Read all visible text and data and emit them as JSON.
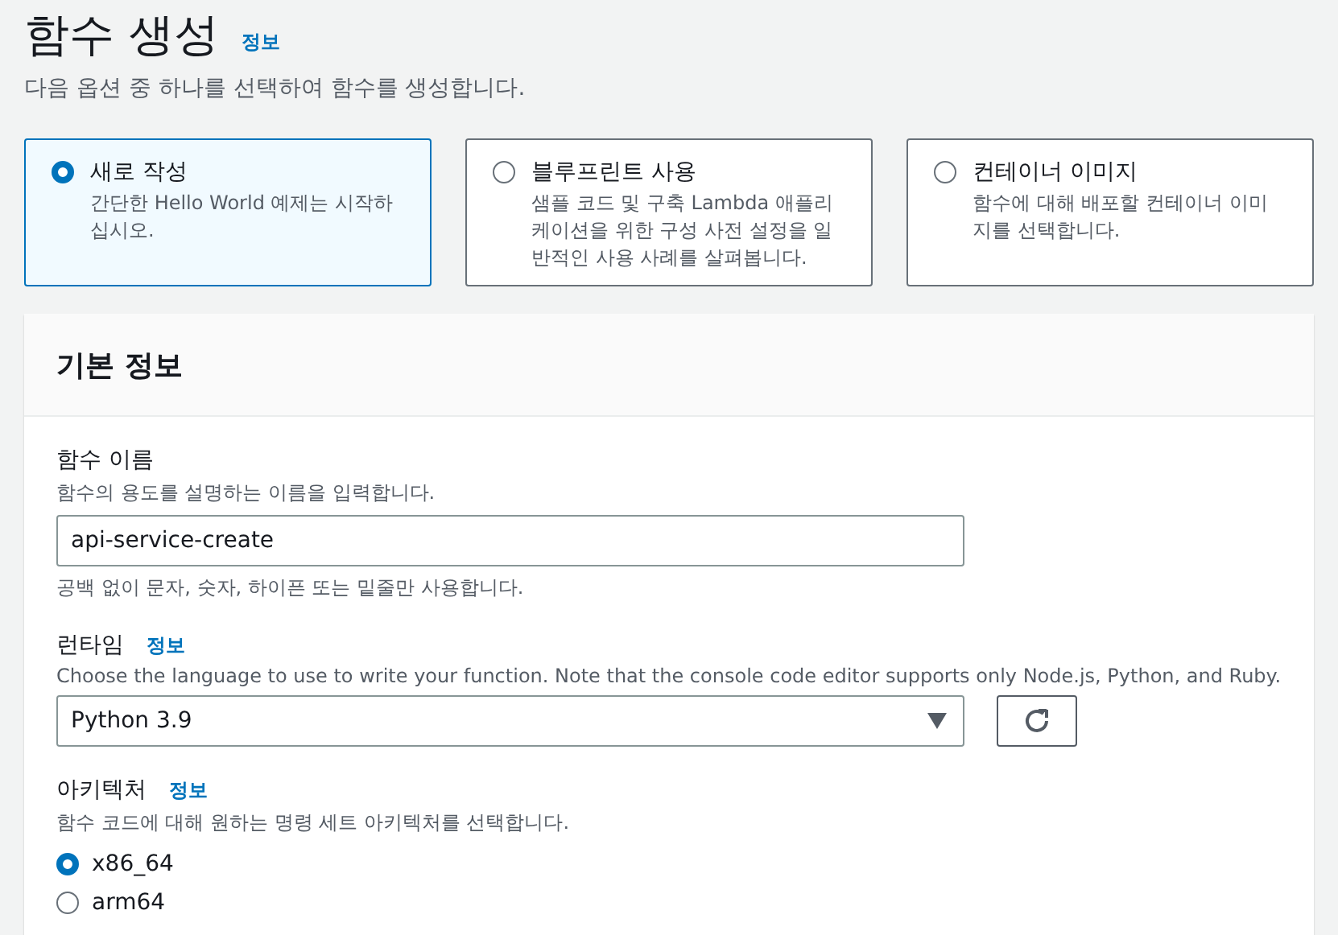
{
  "header": {
    "title": "함수 생성",
    "info_link": "정보",
    "description": "다음 옵션 중 하나를 선택하여 함수를 생성합니다."
  },
  "options": [
    {
      "title": "새로 작성",
      "description": "간단한 Hello World 예제는 시작하십시오.",
      "selected": true
    },
    {
      "title": "블루프린트 사용",
      "description": "샘플 코드 및 구축 Lambda 애플리케이션을 위한 구성 사전 설정을 일반적인 사용 사례를 살펴봅니다.",
      "selected": false
    },
    {
      "title": "컨테이너 이미지",
      "description": "함수에 대해 배포할 컨테이너 이미지를 선택합니다.",
      "selected": false
    }
  ],
  "panel": {
    "title": "기본 정보",
    "function_name": {
      "label": "함수 이름",
      "description": "함수의 용도를 설명하는 이름을 입력합니다.",
      "value": "api-service-create",
      "constraint": "공백 없이 문자, 숫자, 하이픈 또는 밑줄만 사용합니다."
    },
    "runtime": {
      "label": "런타임",
      "info_link": "정보",
      "description": "Choose the language to use to write your function. Note that the console code editor supports only Node.js, Python, and Ruby.",
      "value": "Python 3.9"
    },
    "architecture": {
      "label": "아키텍처",
      "info_link": "정보",
      "description": "함수 코드에 대해 원하는 명령 세트 아키텍처를 선택합니다.",
      "choices": [
        {
          "label": "x86_64",
          "selected": true
        },
        {
          "label": "arm64",
          "selected": false
        }
      ]
    }
  }
}
